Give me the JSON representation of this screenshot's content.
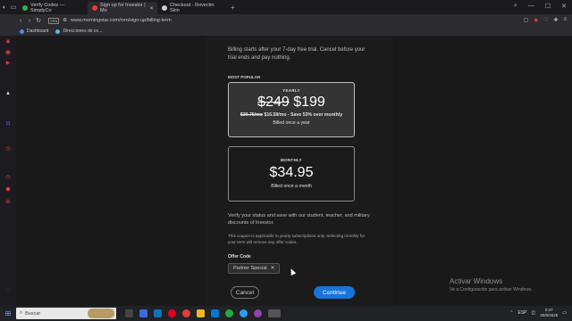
{
  "browser": {
    "tabs": [
      {
        "label": "Verify Codes — SimplyCo",
        "favicon_color": "#33b24a",
        "active": false
      },
      {
        "label": "Sign up for Investor | Mo",
        "favicon_color": "#e23b3b",
        "active": true
      },
      {
        "label": "Checkout - Rovectin Skin",
        "favicon_color": "#cccccc",
        "active": false
      }
    ],
    "new_tab": "+",
    "url": "www.morningstar.com/mm/sign-up/billing-term",
    "bookmarks": [
      "Dashboard",
      "Direcciones de co..."
    ]
  },
  "modal": {
    "intro_text": "Billing starts after your 7-day free trial. Cancel before your trial ends and pay nothing.",
    "most_popular": "MOST POPULAR",
    "yearly": {
      "label": "YEARLY",
      "old_price": "$249",
      "price": "$199",
      "old_monthly": "$20.75/mo",
      "detail": "$16.58/mo - Save 53% over monthly",
      "billing": "Billed once a year"
    },
    "monthly": {
      "label": "MONTHLY",
      "price": "$34.95",
      "billing": "Billed once a month"
    },
    "verify_text": "Verify your status and save with our student, teacher, and military discounts of Investor.",
    "coupon_text": "This coupon is applicable to yearly subscriptions only. Selecting monthly for your term will remove any offer codes.",
    "offer_code_label": "Offer Code",
    "offer_chip": "Partner Special",
    "cancel_label": "Cancel",
    "continue_label": "Continue",
    "accent_color": "#1a73d9"
  },
  "watermark": {
    "title": "Activar Windows",
    "subtitle": "Ve a Configuración para activar Windows."
  },
  "taskbar": {
    "search_placeholder": "Buscar",
    "language": "ESP",
    "time": "0:47",
    "date": "30/6/2025"
  }
}
